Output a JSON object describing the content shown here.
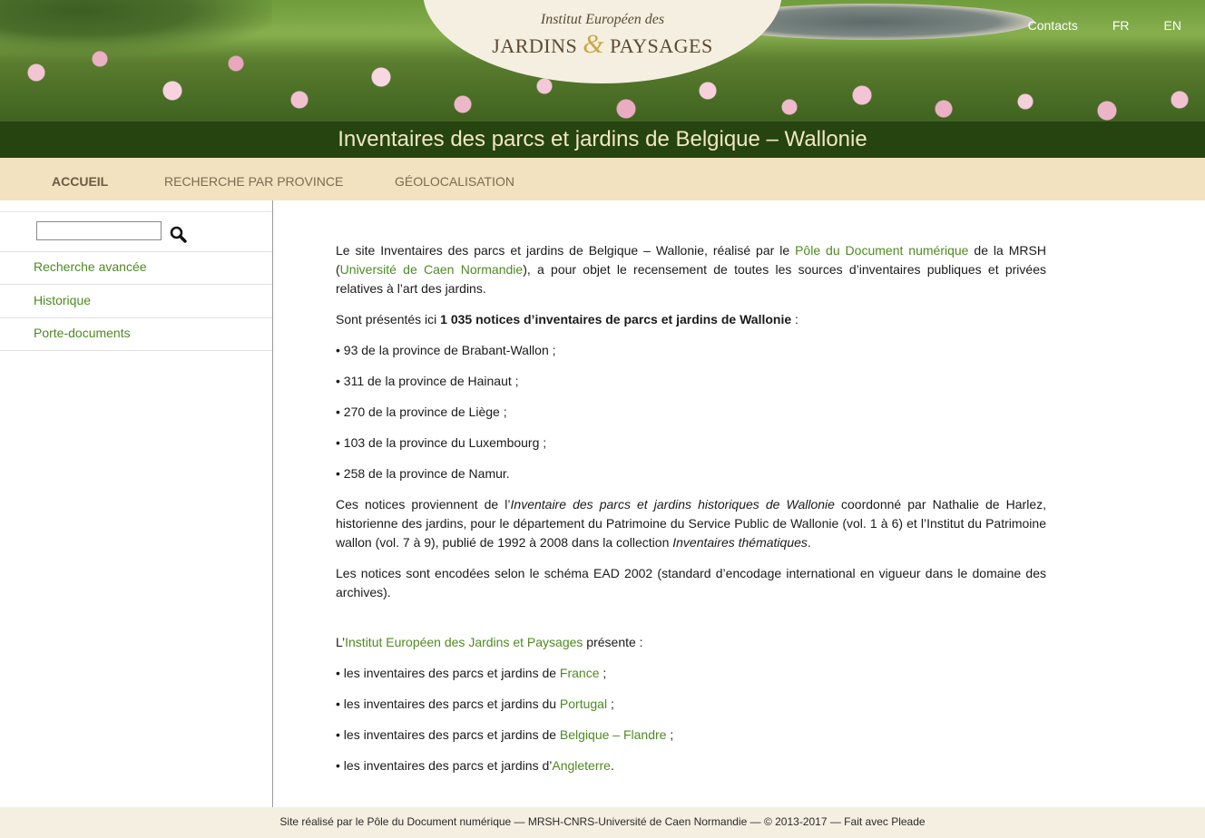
{
  "header": {
    "logo_line1": "Institut Européen des",
    "logo_word1": "JARDINS",
    "logo_amp": "&",
    "logo_word2": "PAYSAGES",
    "links": [
      "Contacts",
      "FR",
      "EN"
    ]
  },
  "title": "Inventaires des parcs et jardins de Belgique – Wallonie",
  "nav": {
    "items": [
      "ACCUEIL",
      "RECHERCHE PAR PROVINCE",
      "GÉOLOCALISATION"
    ],
    "active": "ACCUEIL"
  },
  "sidebar": {
    "search": {
      "value": "",
      "placeholder": ""
    },
    "items": [
      "Recherche avancée",
      "Historique",
      "Porte-documents"
    ]
  },
  "content": {
    "p1": {
      "t1": "Le site Inventaires des parcs et jardins de Belgique – Wallonie, réalisé par le ",
      "link1": "Pôle du Document numérique",
      "t2": " de la MRSH (",
      "link2": "Université de Caen Normandie",
      "t3": "), a pour objet le recensement de toutes les sources d’inventaires publiques et privées relatives à l’art des jardins."
    },
    "p2": {
      "t1": "Sont présentés ici ",
      "bold": "1 035 notices d’inventaires de parcs et jardins de Wallonie",
      "t2": " :"
    },
    "provinces": [
      "• 93 de la province de Brabant-Wallon ;",
      "• 311 de la province de Hainaut ;",
      "• 270 de la province de Liège ;",
      "• 103 de la province du Luxembourg ;",
      "• 258 de la province de Namur."
    ],
    "p3": {
      "t1": "Ces notices proviennent de l’",
      "italic1": "Inventaire des parcs et jardins historiques de Wallonie",
      "t2": " coordonné par Nathalie de Harlez, historienne des jardins, pour le département du Patrimoine du Service Public de Wallonie (vol. 1 à 6) et l’Institut du Patrimoine wallon (vol. 7 à 9), publié de 1992 à 2008 dans la collection ",
      "italic2": "Inventaires thématiques",
      "t3": "."
    },
    "p4": "Les notices sont encodées selon le schéma EAD 2002 (standard d’encodage international en vigueur dans le domaine des archives).",
    "p5": {
      "t1": "L’",
      "link": "Institut Européen des Jardins et Paysages",
      "t2": " présente :"
    },
    "others": [
      {
        "pre": "• les inventaires des parcs et jardins de ",
        "link": "France",
        "post": " ;"
      },
      {
        "pre": "• les inventaires des parcs et jardins du ",
        "link": "Portugal",
        "post": " ;"
      },
      {
        "pre": "• les inventaires des parcs et jardins de ",
        "link": "Belgique – Flandre",
        "post": " ;"
      },
      {
        "pre": "• les inventaires des parcs et jardins d’",
        "link": "Angleterre",
        "post": "."
      }
    ]
  },
  "footer": "Site réalisé par le Pôle du Document numérique — MRSH-CNRS-Université de Caen Normandie — © 2013-2017 — Fait avec Pleade",
  "colors": {
    "title_bar": "#254410",
    "title_text": "#f2e6c4",
    "nav_bg": "#f2e2bf",
    "link": "#4e8a21",
    "footer_bg": "#f5efe2"
  },
  "icons": {
    "search_button": "search-icon"
  }
}
